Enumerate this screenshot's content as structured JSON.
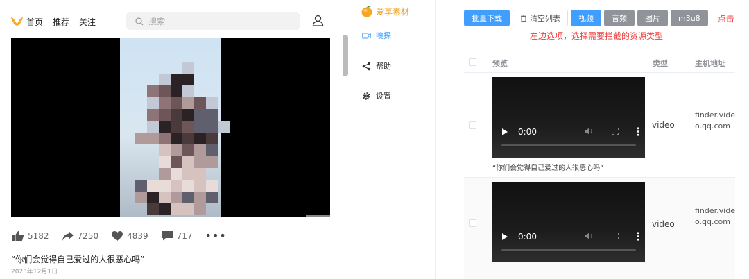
{
  "feed": {
    "nav": {
      "home": "首页",
      "recommend": "推荐",
      "follow": "关注"
    },
    "search": {
      "placeholder": "搜索"
    },
    "stats": {
      "likes": "5182",
      "shares": "7250",
      "favorites": "4839",
      "comments": "717"
    },
    "caption": "“你们会觉得自己爱过的人很恶心吗”",
    "date": "2023年12月1日"
  },
  "sidebar": {
    "brand": "爱享素材",
    "items": [
      {
        "label": "嗅探",
        "icon": "video-camera-icon",
        "active": true
      },
      {
        "label": "帮助",
        "icon": "share-icon",
        "active": false
      },
      {
        "label": "设置",
        "icon": "gear-icon",
        "active": false
      }
    ],
    "brand_color": "#f0a020",
    "active_color": "#409eff"
  },
  "toolbar": {
    "batch_download": "批量下载",
    "clear_list": "清空列表",
    "types": [
      {
        "label": "视频",
        "active": true
      },
      {
        "label": "音频",
        "active": false
      },
      {
        "label": "图片",
        "active": false
      },
      {
        "label": "m3u8",
        "active": false
      }
    ],
    "click_hint": "点击",
    "select_hint": "左边选项，选择需要拦截的资源类型"
  },
  "table": {
    "headers": {
      "preview": "预览",
      "type": "类型",
      "host": "主机地址"
    },
    "rows": [
      {
        "time": "0:00",
        "type": "video",
        "host": "finder.video.qq.com",
        "caption": "“你们会觉得自己爱过的人很恶心吗”"
      },
      {
        "time": "0:00",
        "type": "video",
        "host": "finder.video.qq.com",
        "caption": ""
      }
    ]
  },
  "colors": {
    "primary": "#409eff",
    "neutral_btn": "#909399",
    "hint_red": "#f04040"
  }
}
